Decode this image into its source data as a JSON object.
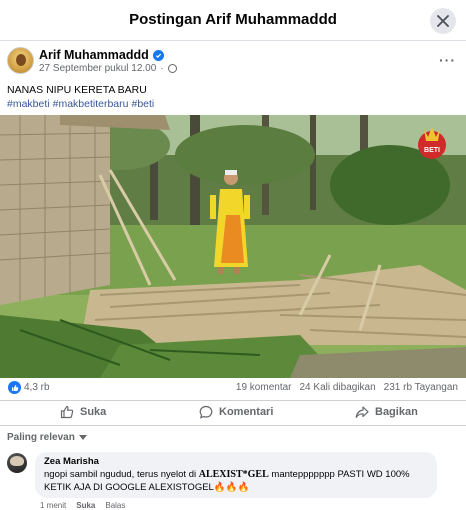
{
  "header": {
    "title": "Postingan Arif Muhammaddd"
  },
  "post": {
    "author": "Arif Muhammaddd",
    "timestamp": "27 September pukul 12.00",
    "dot": "·",
    "caption": "NANAS NIPU KERETA BARU",
    "hashtags": [
      "#makbeti",
      "#makbetiterbaru",
      "#beti"
    ],
    "video_badge": "BETI"
  },
  "stats": {
    "reactions": "4,3 rb",
    "comments": "19 komentar",
    "shares": "24 Kali dibagikan",
    "views": "231 rb Tayangan"
  },
  "actions": {
    "like": "Suka",
    "comment": "Komentari",
    "share": "Bagikan"
  },
  "comments_sort": "Paling relevan",
  "comment": {
    "name": "Zea Marisha",
    "text_before": "ngopi sambil ngudud, terus nyelot di ",
    "text_bold": "ALEXIST*GEL",
    "text_after": " manteppppppp PASTI WD 100%",
    "text_line2": "KETIK AJA DI GOOGLE ALEXISTOGEL🔥🔥🔥",
    "time": "1 menit",
    "like": "Suka",
    "reply": "Balas"
  },
  "colors": {
    "accent": "#1877f2",
    "link": "#385898",
    "muted": "#65676b",
    "bubble": "#f0f2f5"
  },
  "icons": {
    "close": "close-icon",
    "verified": "verified-badge-icon",
    "privacy": "globe-icon",
    "more": "more-horizontal-icon",
    "like": "thumbs-up-icon",
    "comment": "comment-bubble-icon",
    "share": "share-arrow-icon",
    "sort": "chevron-down-icon"
  }
}
